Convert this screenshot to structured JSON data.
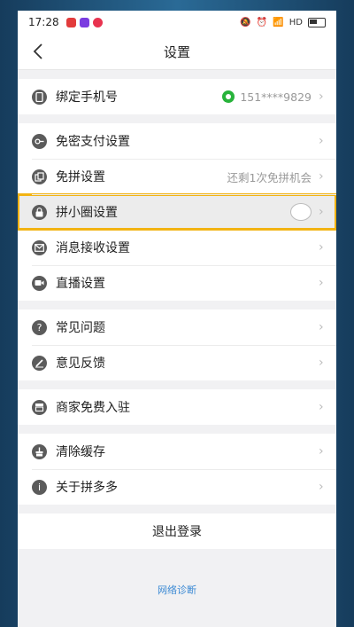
{
  "status": {
    "time": "17:28",
    "network": "HD"
  },
  "nav": {
    "title": "设置"
  },
  "groups": [
    [
      {
        "label": "绑定手机号",
        "value": "151****9829",
        "icon": "phone-icon"
      }
    ],
    [
      {
        "label": "免密支付设置",
        "icon": "key-icon"
      },
      {
        "label": "免拼设置",
        "value": "还剩1次免拼机会",
        "icon": "copy-icon"
      },
      {
        "label": "拼小圈设置",
        "icon": "lock-icon",
        "highlight": true
      },
      {
        "label": "消息接收设置",
        "icon": "mail-icon"
      },
      {
        "label": "直播设置",
        "icon": "video-icon"
      }
    ],
    [
      {
        "label": "常见问题",
        "icon": "question-icon"
      },
      {
        "label": "意见反馈",
        "icon": "pen-icon"
      }
    ],
    [
      {
        "label": "商家免费入驻",
        "icon": "store-icon"
      }
    ],
    [
      {
        "label": "清除缓存",
        "icon": "broom-icon"
      },
      {
        "label": "关于拼多多",
        "icon": "info-icon"
      }
    ]
  ],
  "logout": {
    "label": "退出登录"
  },
  "footer": {
    "diagnose_label": "网络诊断"
  },
  "colors": {
    "highlight_border": "#f2b313",
    "link": "#3c8ad4",
    "wechat_green": "#28b33b"
  }
}
